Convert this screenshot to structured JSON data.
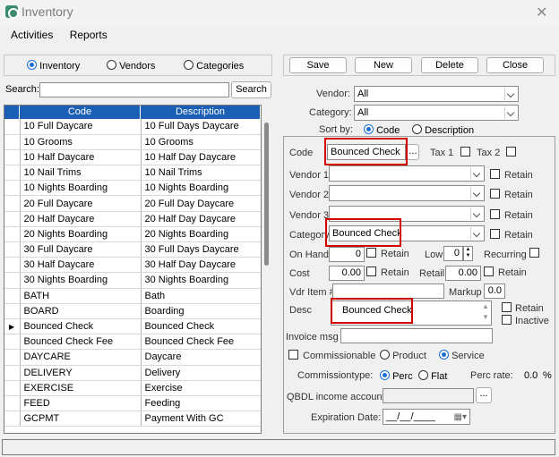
{
  "window": {
    "title": "Inventory"
  },
  "menu": [
    "Activities",
    "Reports"
  ],
  "filter": {
    "options": [
      "Inventory",
      "Vendors",
      "Categories"
    ],
    "selected": 0
  },
  "search": {
    "label": "Search:",
    "button": "Search",
    "value": ""
  },
  "grid": {
    "columns": [
      "Code",
      "Description"
    ],
    "rows": [
      [
        "10 Full Daycare",
        "10 Full Days Daycare"
      ],
      [
        "10 Grooms",
        "10 Grooms"
      ],
      [
        "10 Half Daycare",
        "10 Half Day Daycare"
      ],
      [
        "10 Nail Trims",
        "10 Nail Trims"
      ],
      [
        "10 Nights Boarding",
        "10 Nights Boarding"
      ],
      [
        "20 Full Daycare",
        "20 Full Day Daycare"
      ],
      [
        "20 Half Daycare",
        "20 Half Day Daycare"
      ],
      [
        "20 Nights Boarding",
        "20 Nights Boarding"
      ],
      [
        "30 Full Daycare",
        "30 Full Days Daycare"
      ],
      [
        "30 Half Daycare",
        "30 Half Day Daycare"
      ],
      [
        "30 Nights Boarding",
        "30 Nights Boarding"
      ],
      [
        "BATH",
        "Bath"
      ],
      [
        "BOARD",
        "Boarding"
      ],
      [
        "Bounced Check",
        "Bounced Check"
      ],
      [
        "Bounced Check Fee",
        "Bounced Check Fee"
      ],
      [
        "DAYCARE",
        "Daycare"
      ],
      [
        "DELIVERY",
        "Delivery"
      ],
      [
        "EXERCISE",
        "Exercise"
      ],
      [
        "FEED",
        "Feeding"
      ],
      [
        "GCPMT",
        "Payment With GC"
      ]
    ],
    "selected_row": 13
  },
  "actions": {
    "save": "Save",
    "new": "New",
    "delete": "Delete",
    "close": "Close"
  },
  "top_filters": {
    "vendor_label": "Vendor:",
    "vendor_value": "All",
    "category_label": "Category:",
    "category_value": "All",
    "sortby_label": "Sort by:",
    "sort_code": "Code",
    "sort_desc": "Description"
  },
  "form": {
    "code_label": "Code",
    "code_value": "Bounced Check",
    "ellipsis": "...",
    "tax1": "Tax 1",
    "tax2": "Tax 2",
    "vendor1": "Vendor 1",
    "vendor2": "Vendor 2",
    "vendor3": "Vendor 3",
    "retain": "Retain",
    "category_label": "Category",
    "category_value": "Bounced Check",
    "onhand_label": "On Hand",
    "onhand_value": "0",
    "low_label": "Low",
    "low_value": "0",
    "recurring": "Recurring",
    "cost_label": "Cost",
    "cost_value": "0.00",
    "retail_label": "Retail",
    "retail_value": "0.00",
    "vdr_label": "Vdr Item #",
    "markup_label": "Markup",
    "markup_value": "0.0",
    "desc_label": "Desc",
    "desc_value": "Bounced Check",
    "inactive": "Inactive",
    "invoice_msg": "Invoice msg",
    "commissionable": "Commissionable",
    "product": "Product",
    "service": "Service",
    "commission_type": "Commissiontype:",
    "perc": "Perc",
    "flat": "Flat",
    "perc_rate_label": "Perc rate:",
    "perc_rate_value": "0.0",
    "percent_sign": "%",
    "qbdl_label": "QBDL income account:",
    "exp_label": "Expiration Date:",
    "exp_value": "__/__/____"
  },
  "colors": {
    "header": "#1a5fb4",
    "highlight": "#d40000",
    "accent": "#1a6fd6"
  }
}
